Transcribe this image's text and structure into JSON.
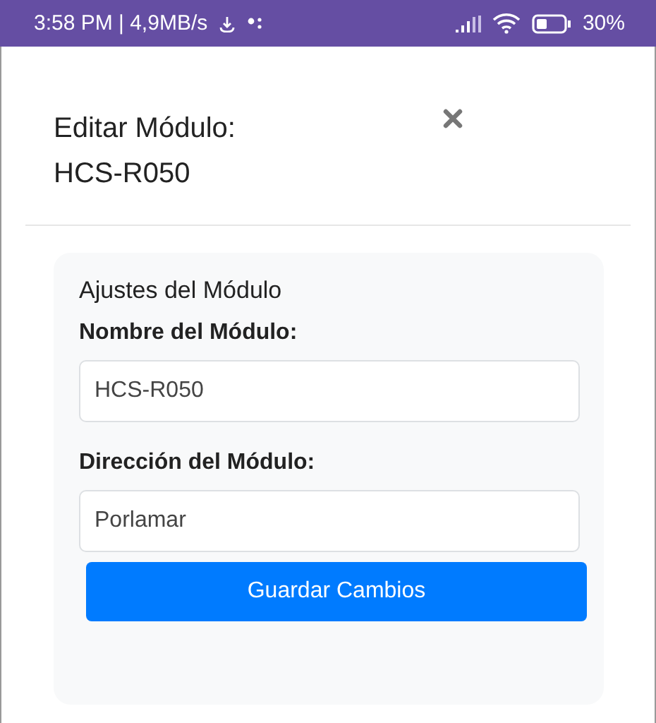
{
  "status_bar": {
    "time": "3:58 PM | 4,9MB/s",
    "battery": "30%"
  },
  "dialog": {
    "title": "Editar Módulo:",
    "subtitle": "HCS-R050"
  },
  "card": {
    "heading": "Ajustes del Módulo",
    "fields": [
      {
        "label": "Nombre del Módulo:",
        "value": "HCS-R050"
      },
      {
        "label": "Dirección del Módulo:",
        "value": "Porlamar"
      }
    ],
    "button": "Guardar Cambios"
  }
}
